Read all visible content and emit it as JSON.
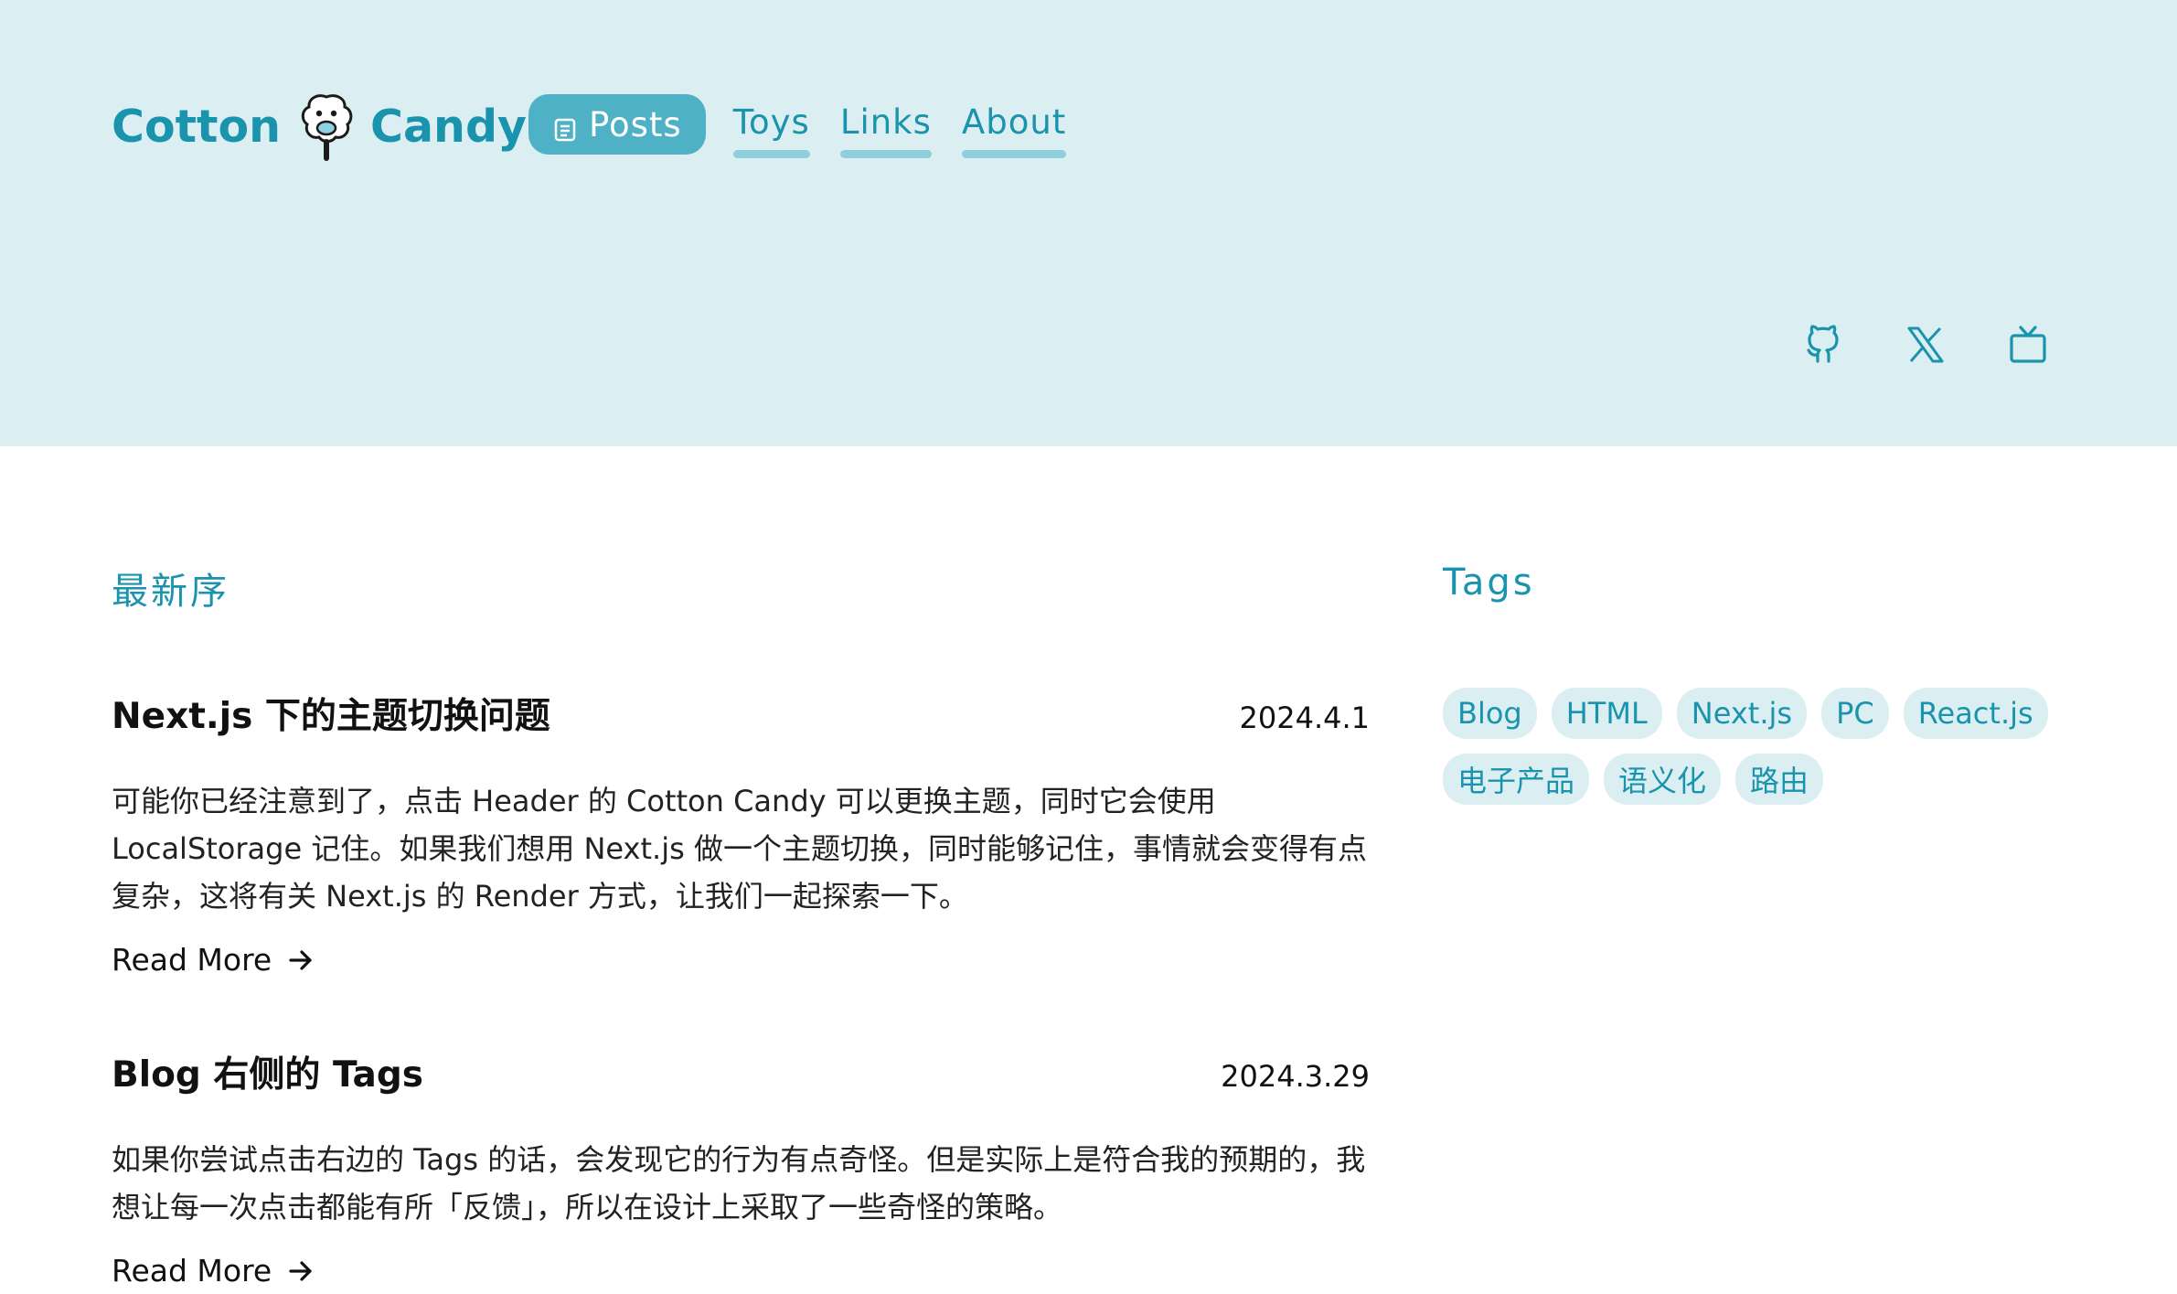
{
  "header": {
    "brand_left": "Cotton",
    "brand_right": "Candy",
    "nav": {
      "active": "Posts",
      "links": [
        "Toys",
        "Links",
        "About"
      ]
    },
    "socials": [
      "github-icon",
      "x-icon",
      "tv-icon"
    ]
  },
  "main": {
    "posts_title": "最新序",
    "posts": [
      {
        "title": "Next.js 下的主题切换问题",
        "date": "2024.4.1",
        "excerpt": "可能你已经注意到了，点击 Header 的 Cotton Candy 可以更换主题，同时它会使用 LocalStorage 记住。如果我们想用 Next.js 做一个主题切换，同时能够记住，事情就会变得有点复杂，这将有关 Next.js 的 Render 方式，让我们一起探索一下。",
        "read_more": "Read More"
      },
      {
        "title": "Blog 右侧的 Tags",
        "date": "2024.3.29",
        "excerpt": "如果你尝试点击右边的 Tags 的话，会发现它的行为有点奇怪。但是实际上是符合我的预期的，我想让每一次点击都能有所「反馈」，所以在设计上采取了一些奇怪的策略。",
        "read_more": "Read More"
      }
    ]
  },
  "sidebar": {
    "tags_title": "Tags",
    "tags": [
      "Blog",
      "HTML",
      "Next.js",
      "PC",
      "React.js",
      "电子产品",
      "语义化",
      "路由"
    ]
  },
  "colors": {
    "accent": "#1a93ac",
    "header_bg": "#dbeff3",
    "nav_active_bg": "#4fb1c5",
    "underline": "#8fcfdd"
  }
}
